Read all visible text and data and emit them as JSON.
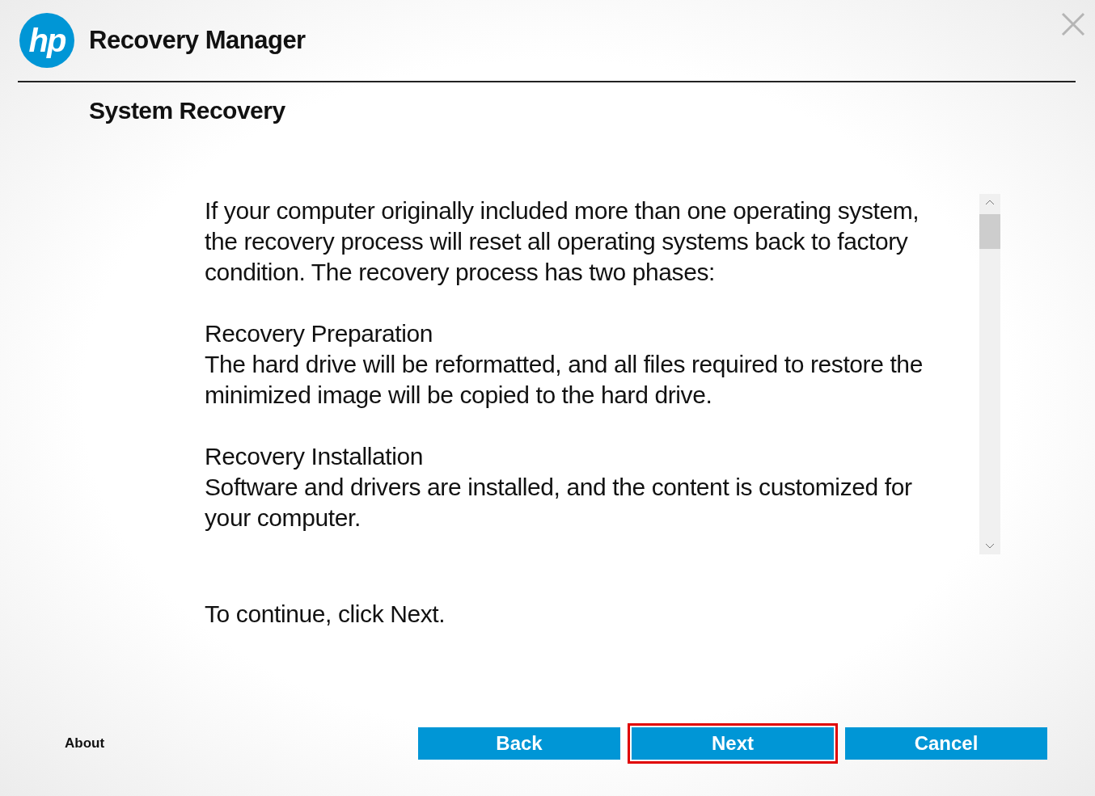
{
  "window": {
    "logo": "hp",
    "title": "Recovery Manager"
  },
  "page_title": "System Recovery",
  "content": {
    "intro": "If your computer originally included more than one operating system, the recovery process will reset all operating systems back to factory condition. The recovery process has two phases:",
    "sections": [
      {
        "heading": "Recovery Preparation",
        "text": "The hard drive will be reformatted, and all files required to restore the minimized image will be copied to the hard drive."
      },
      {
        "heading": "Recovery Installation",
        "text": "Software and drivers are installed, and the content is customized for your computer."
      }
    ]
  },
  "instruction": "To continue, click Next.",
  "about": "About",
  "buttons": [
    {
      "label": "Back",
      "highlighted": false
    },
    {
      "label": "Next",
      "highlighted": true
    },
    {
      "label": "Cancel",
      "highlighted": false
    }
  ]
}
